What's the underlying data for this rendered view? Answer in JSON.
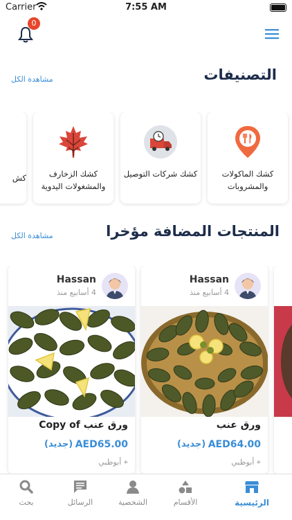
{
  "status_bar": {
    "carrier": "Carrier",
    "time": "7:55 AM"
  },
  "header": {
    "notification_count": "0"
  },
  "categories": {
    "title": "التصنيفات",
    "see_all": "مشاهدة الكل",
    "items": [
      {
        "label": "كشك الماكولات والمشروبات",
        "icon": "food-pin-icon"
      },
      {
        "label": "كشك شركات التوصيل",
        "icon": "delivery-truck-icon"
      },
      {
        "label": "كشك الزخارف والمشغولات اليدوية",
        "icon": "maple-leaf-icon"
      },
      {
        "label": "كش",
        "icon": "partial-icon"
      }
    ]
  },
  "products": {
    "title": "المنتجات المضافة مؤخرا",
    "see_all": "مشاهدة الكل",
    "items": [
      {
        "seller": "Hassan",
        "ago": "4 أسابيع منذ",
        "name": "ورق عنب",
        "price": "AED64.00",
        "condition": "(جديد)",
        "location": "أبوظبي"
      },
      {
        "seller": "Hassan",
        "ago": "4 أسابيع منذ",
        "name": "ورق عنب Copy of",
        "price": "AED65.00",
        "condition": "(جديد)",
        "location": "أبوظبي"
      }
    ]
  },
  "tabbar": {
    "items": [
      {
        "label": "الرئيسية",
        "icon": "store-icon",
        "active": true
      },
      {
        "label": "الأقسام",
        "icon": "shapes-icon",
        "active": false
      },
      {
        "label": "الشخصية",
        "icon": "person-icon",
        "active": false
      },
      {
        "label": "الرسائل",
        "icon": "chat-icon",
        "active": false
      },
      {
        "label": "بحث",
        "icon": "search-icon",
        "active": false
      }
    ]
  },
  "colors": {
    "accent": "#3a8dd6",
    "title": "#1d2c4a",
    "badge": "#e8452c"
  }
}
